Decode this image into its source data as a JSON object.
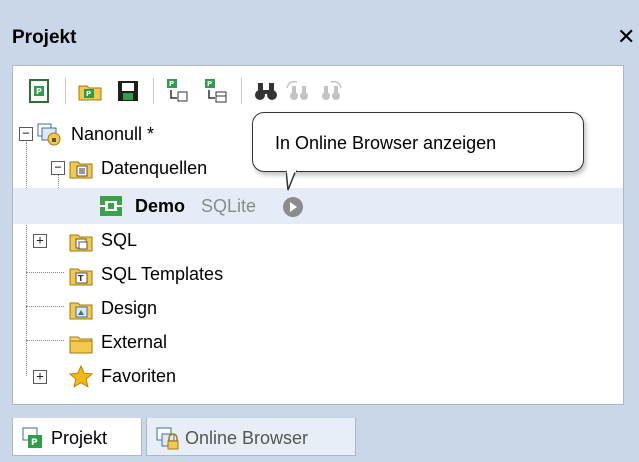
{
  "window": {
    "title": "Projekt",
    "close_label": "✕"
  },
  "toolbar": {
    "buttons": [
      {
        "icon": "new-project-icon"
      },
      {
        "icon": "open-project-icon"
      },
      {
        "icon": "save-project-icon"
      },
      {
        "icon": "add-file-to-project-icon"
      },
      {
        "icon": "add-active-file-icon"
      },
      {
        "icon": "find-icon"
      },
      {
        "icon": "find-next-icon"
      },
      {
        "icon": "find-previous-icon"
      }
    ]
  },
  "tree": {
    "root_label": "Nanonull *",
    "datasources_label": "Datenquellen",
    "demo_label": "Demo",
    "demo_type": "SQLite",
    "sql_label": "SQL",
    "sql_templates_label": "SQL Templates",
    "design_label": "Design",
    "external_label": "External",
    "favorites_label": "Favoriten"
  },
  "tooltip": {
    "text": "In Online Browser anzeigen"
  },
  "tabs": {
    "projekt_label": "Projekt",
    "online_browser_label": "Online Browser"
  },
  "colors": {
    "titlebar": "#c9d7e8",
    "selection": "#e5ecf7",
    "folder": "#f2c94c",
    "green": "#3aa34a"
  }
}
